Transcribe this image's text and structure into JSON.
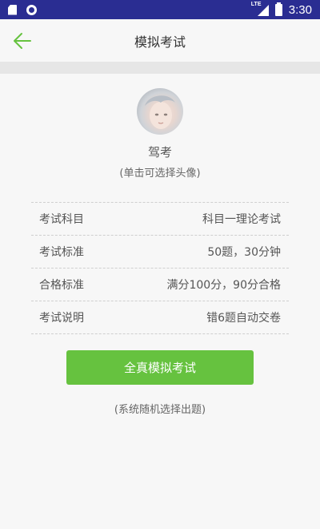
{
  "status_bar": {
    "time": "3:30",
    "network": "LTE",
    "icons": [
      "sd-card-icon",
      "circle-icon",
      "lte-signal-icon",
      "battery-icon"
    ]
  },
  "header": {
    "title": "模拟考试",
    "back_icon": "arrow-left-icon",
    "accent_color": "#66c23f"
  },
  "profile": {
    "name": "驾考",
    "hint": "(单击可选择头像)"
  },
  "exam_info": [
    {
      "label": "考试科目",
      "value": "科目一理论考试"
    },
    {
      "label": "考试标准",
      "value": "50题，30分钟"
    },
    {
      "label": "合格标准",
      "value": "满分100分，90分合格"
    },
    {
      "label": "考试说明",
      "value": "错6题自动交卷"
    }
  ],
  "actions": {
    "start_label": "全真模拟考试",
    "footnote": "(系统随机选择出题)"
  }
}
